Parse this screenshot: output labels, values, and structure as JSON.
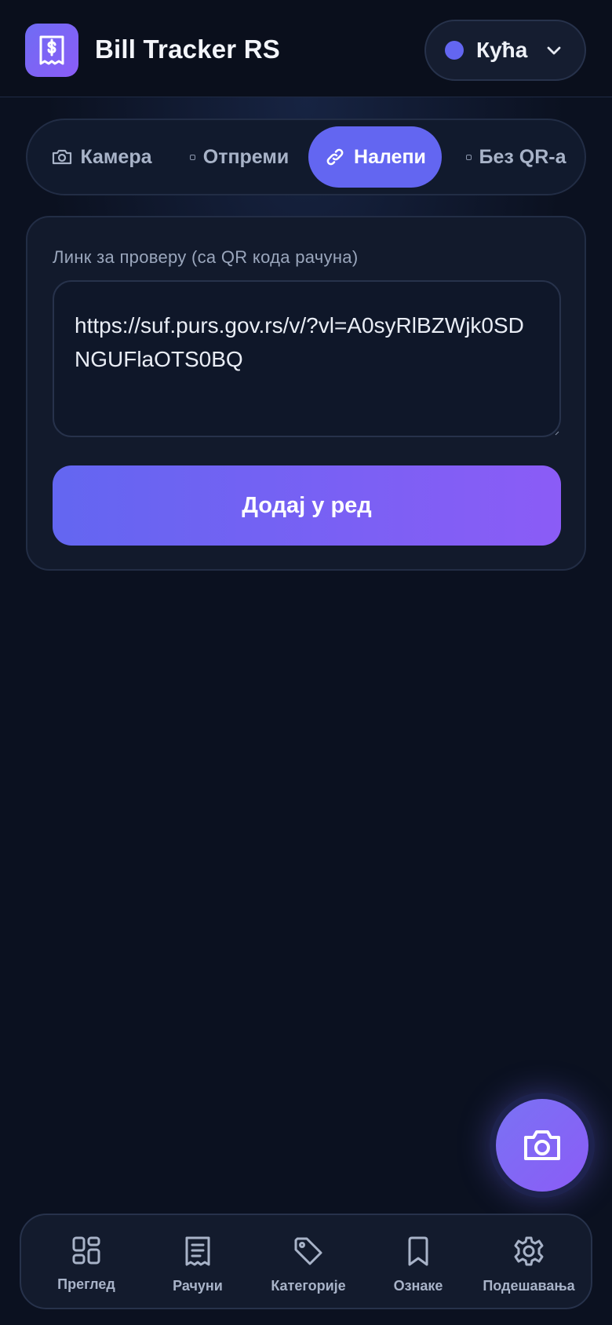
{
  "header": {
    "app_title": "Bill Tracker RS",
    "profile_name": "Кућа",
    "profile_color": "#6366f1",
    "logo_icon": "receipt-dollar-icon"
  },
  "tabs": [
    {
      "label": "Камера",
      "icon": "camera-icon",
      "active": false
    },
    {
      "label": "Отпреми",
      "icon": "file-icon",
      "active": false
    },
    {
      "label": "Налепи",
      "icon": "link-icon",
      "active": true
    },
    {
      "label": "Без QR-а",
      "icon": "file-icon",
      "active": false
    }
  ],
  "paste_card": {
    "field_label": "Линк за проверу (са QR кода рачуна)",
    "url_value": "https://suf.purs.gov.rs/v/?vl=A0syRlBZWjk0SDNGUFlaOTS0BQ",
    "add_button_label": "Додај у ред"
  },
  "fab": {
    "icon": "camera-icon"
  },
  "bottom_nav": [
    {
      "label": "Преглед",
      "icon": "grid-icon"
    },
    {
      "label": "Рачуни",
      "icon": "receipt-icon"
    },
    {
      "label": "Категорије",
      "icon": "tag-icon"
    },
    {
      "label": "Ознаке",
      "icon": "bookmark-icon"
    },
    {
      "label": "Подешавања",
      "icon": "gear-icon"
    }
  ],
  "colors": {
    "accent": "#6366f1",
    "accent_end": "#8b5cf6",
    "background": "#0b1120"
  }
}
